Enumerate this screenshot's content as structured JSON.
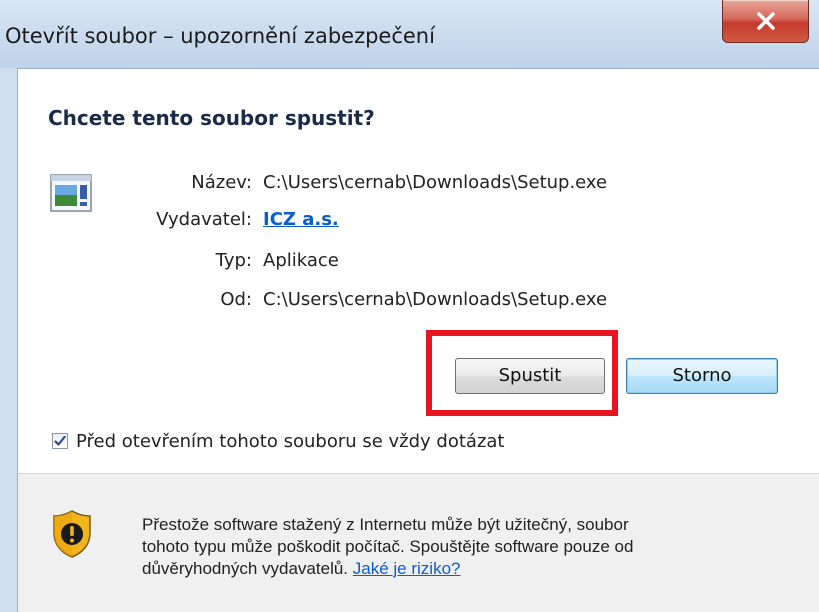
{
  "window": {
    "title": "Otevřít soubor – upozornění zabezpečení",
    "close_label": "X"
  },
  "dialog": {
    "heading": "Chcete tento soubor spustit?",
    "fields": [
      {
        "label": "Název:",
        "value": "C:\\Users\\cernab\\Downloads\\Setup.exe"
      },
      {
        "label": "Vydavatel:",
        "value": "ICZ a.s."
      },
      {
        "label": "Typ:",
        "value": "Aplikace"
      },
      {
        "label": "Od:",
        "value": "C:\\Users\\cernab\\Downloads\\Setup.exe"
      }
    ],
    "buttons": {
      "run": "Spustit",
      "cancel": "Storno"
    },
    "checkbox": {
      "label": "Před otevřením tohoto souboru se vždy dotázat",
      "checked": true
    },
    "warning": {
      "line1": "Přestože software stažený z Internetu může být užitečný, soubor",
      "line2": "tohoto typu může poškodit počítač. Spouštějte software pouze od",
      "line3_prefix": "důvěryhodných vydavatelů.",
      "risk_link": "Jaké je riziko?"
    }
  },
  "icons": {
    "file": "application-file-icon",
    "shield": "security-warning-shield-icon",
    "check": "checkmark-icon"
  },
  "colors": {
    "highlight_box": "#e5161f",
    "link": "#0b5cd1",
    "close_button": "#c43a2c"
  }
}
